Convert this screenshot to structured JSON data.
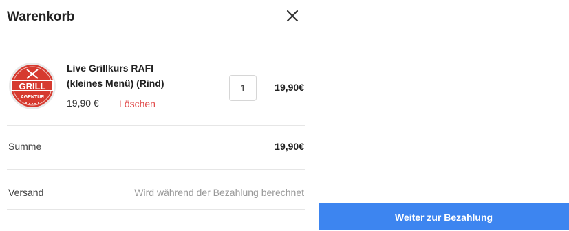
{
  "cart": {
    "title": "Warenkorb",
    "close_icon": "close-icon"
  },
  "item": {
    "name_line1": "Live Grillkurs RAFI",
    "name_line2": "(kleines Menü) (Rind)",
    "price": "19,90 €",
    "delete_label": "Löschen",
    "quantity": "1",
    "line_total": "19,90€",
    "logo": {
      "text_top": "GRILL",
      "text_bottom": "AGENTUR",
      "color": "#d63a2f"
    }
  },
  "summary": {
    "sum_label": "Summe",
    "sum_value": "19,90€",
    "shipping_label": "Versand",
    "shipping_value": "Wird während der Bezahlung berechnet"
  },
  "checkout": {
    "button_label": "Weiter zur Bezahlung",
    "color": "#3d85f0"
  }
}
